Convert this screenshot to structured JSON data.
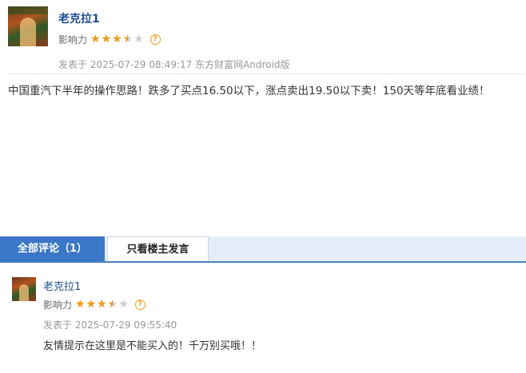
{
  "post": {
    "author": "老克拉1",
    "influence_label": "影响力",
    "influence_rating": 3.5,
    "influence_max": 5,
    "stars_glyphs": "★★★★★",
    "help_glyph": "?",
    "meta": "发表于 2025-07-29 08:49:17 东方财富网Android版",
    "body": "中国重汽下半年的操作思路！跌多了买点16.50以下，涨点卖出19.50以下卖！150天等年底看业绩！"
  },
  "tabs": [
    {
      "label": "全部评论（1）",
      "active": true
    },
    {
      "label": "只看楼主发言",
      "active": false
    }
  ],
  "comments": [
    {
      "author": "老克拉1",
      "influence_label": "影响力",
      "influence_rating": 3.5,
      "meta": "发表于 2025-07-29 09:55:40",
      "body": "友情提示在这里是不能买入的！千万别买哦！！"
    }
  ],
  "colors": {
    "accent": "#3a77c6",
    "star": "#f19a1a",
    "name": "#1f4e8c"
  }
}
